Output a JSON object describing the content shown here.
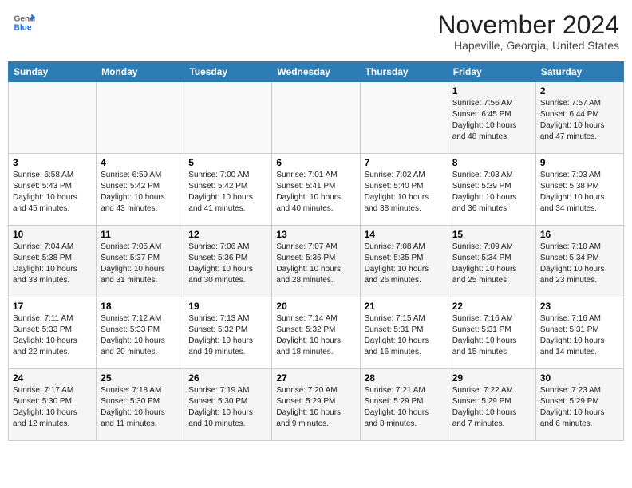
{
  "header": {
    "logo": {
      "line1": "General",
      "line2": "Blue"
    },
    "title": "November 2024",
    "location": "Hapeville, Georgia, United States"
  },
  "weekdays": [
    "Sunday",
    "Monday",
    "Tuesday",
    "Wednesday",
    "Thursday",
    "Friday",
    "Saturday"
  ],
  "weeks": [
    [
      {
        "day": "",
        "info": ""
      },
      {
        "day": "",
        "info": ""
      },
      {
        "day": "",
        "info": ""
      },
      {
        "day": "",
        "info": ""
      },
      {
        "day": "",
        "info": ""
      },
      {
        "day": "1",
        "info": "Sunrise: 7:56 AM\nSunset: 6:45 PM\nDaylight: 10 hours and 48 minutes."
      },
      {
        "day": "2",
        "info": "Sunrise: 7:57 AM\nSunset: 6:44 PM\nDaylight: 10 hours and 47 minutes."
      }
    ],
    [
      {
        "day": "3",
        "info": "Sunrise: 6:58 AM\nSunset: 5:43 PM\nDaylight: 10 hours and 45 minutes."
      },
      {
        "day": "4",
        "info": "Sunrise: 6:59 AM\nSunset: 5:42 PM\nDaylight: 10 hours and 43 minutes."
      },
      {
        "day": "5",
        "info": "Sunrise: 7:00 AM\nSunset: 5:42 PM\nDaylight: 10 hours and 41 minutes."
      },
      {
        "day": "6",
        "info": "Sunrise: 7:01 AM\nSunset: 5:41 PM\nDaylight: 10 hours and 40 minutes."
      },
      {
        "day": "7",
        "info": "Sunrise: 7:02 AM\nSunset: 5:40 PM\nDaylight: 10 hours and 38 minutes."
      },
      {
        "day": "8",
        "info": "Sunrise: 7:03 AM\nSunset: 5:39 PM\nDaylight: 10 hours and 36 minutes."
      },
      {
        "day": "9",
        "info": "Sunrise: 7:03 AM\nSunset: 5:38 PM\nDaylight: 10 hours and 34 minutes."
      }
    ],
    [
      {
        "day": "10",
        "info": "Sunrise: 7:04 AM\nSunset: 5:38 PM\nDaylight: 10 hours and 33 minutes."
      },
      {
        "day": "11",
        "info": "Sunrise: 7:05 AM\nSunset: 5:37 PM\nDaylight: 10 hours and 31 minutes."
      },
      {
        "day": "12",
        "info": "Sunrise: 7:06 AM\nSunset: 5:36 PM\nDaylight: 10 hours and 30 minutes."
      },
      {
        "day": "13",
        "info": "Sunrise: 7:07 AM\nSunset: 5:36 PM\nDaylight: 10 hours and 28 minutes."
      },
      {
        "day": "14",
        "info": "Sunrise: 7:08 AM\nSunset: 5:35 PM\nDaylight: 10 hours and 26 minutes."
      },
      {
        "day": "15",
        "info": "Sunrise: 7:09 AM\nSunset: 5:34 PM\nDaylight: 10 hours and 25 minutes."
      },
      {
        "day": "16",
        "info": "Sunrise: 7:10 AM\nSunset: 5:34 PM\nDaylight: 10 hours and 23 minutes."
      }
    ],
    [
      {
        "day": "17",
        "info": "Sunrise: 7:11 AM\nSunset: 5:33 PM\nDaylight: 10 hours and 22 minutes."
      },
      {
        "day": "18",
        "info": "Sunrise: 7:12 AM\nSunset: 5:33 PM\nDaylight: 10 hours and 20 minutes."
      },
      {
        "day": "19",
        "info": "Sunrise: 7:13 AM\nSunset: 5:32 PM\nDaylight: 10 hours and 19 minutes."
      },
      {
        "day": "20",
        "info": "Sunrise: 7:14 AM\nSunset: 5:32 PM\nDaylight: 10 hours and 18 minutes."
      },
      {
        "day": "21",
        "info": "Sunrise: 7:15 AM\nSunset: 5:31 PM\nDaylight: 10 hours and 16 minutes."
      },
      {
        "day": "22",
        "info": "Sunrise: 7:16 AM\nSunset: 5:31 PM\nDaylight: 10 hours and 15 minutes."
      },
      {
        "day": "23",
        "info": "Sunrise: 7:16 AM\nSunset: 5:31 PM\nDaylight: 10 hours and 14 minutes."
      }
    ],
    [
      {
        "day": "24",
        "info": "Sunrise: 7:17 AM\nSunset: 5:30 PM\nDaylight: 10 hours and 12 minutes."
      },
      {
        "day": "25",
        "info": "Sunrise: 7:18 AM\nSunset: 5:30 PM\nDaylight: 10 hours and 11 minutes."
      },
      {
        "day": "26",
        "info": "Sunrise: 7:19 AM\nSunset: 5:30 PM\nDaylight: 10 hours and 10 minutes."
      },
      {
        "day": "27",
        "info": "Sunrise: 7:20 AM\nSunset: 5:29 PM\nDaylight: 10 hours and 9 minutes."
      },
      {
        "day": "28",
        "info": "Sunrise: 7:21 AM\nSunset: 5:29 PM\nDaylight: 10 hours and 8 minutes."
      },
      {
        "day": "29",
        "info": "Sunrise: 7:22 AM\nSunset: 5:29 PM\nDaylight: 10 hours and 7 minutes."
      },
      {
        "day": "30",
        "info": "Sunrise: 7:23 AM\nSunset: 5:29 PM\nDaylight: 10 hours and 6 minutes."
      }
    ]
  ]
}
